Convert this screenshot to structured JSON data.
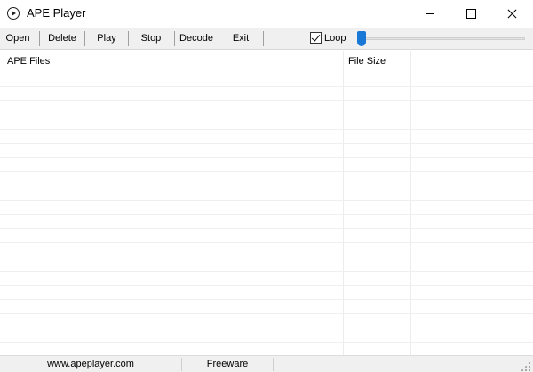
{
  "window": {
    "title": "APE Player"
  },
  "toolbar": {
    "open": "Open",
    "delete": "Delete",
    "play": "Play",
    "stop": "Stop",
    "decode": "Decode",
    "exit": "Exit",
    "loop_label": "Loop",
    "loop_checked": true
  },
  "list": {
    "columns": [
      "APE Files",
      "File Size"
    ],
    "rows": []
  },
  "status": {
    "website": "www.apeplayer.com",
    "license": "Freeware"
  }
}
